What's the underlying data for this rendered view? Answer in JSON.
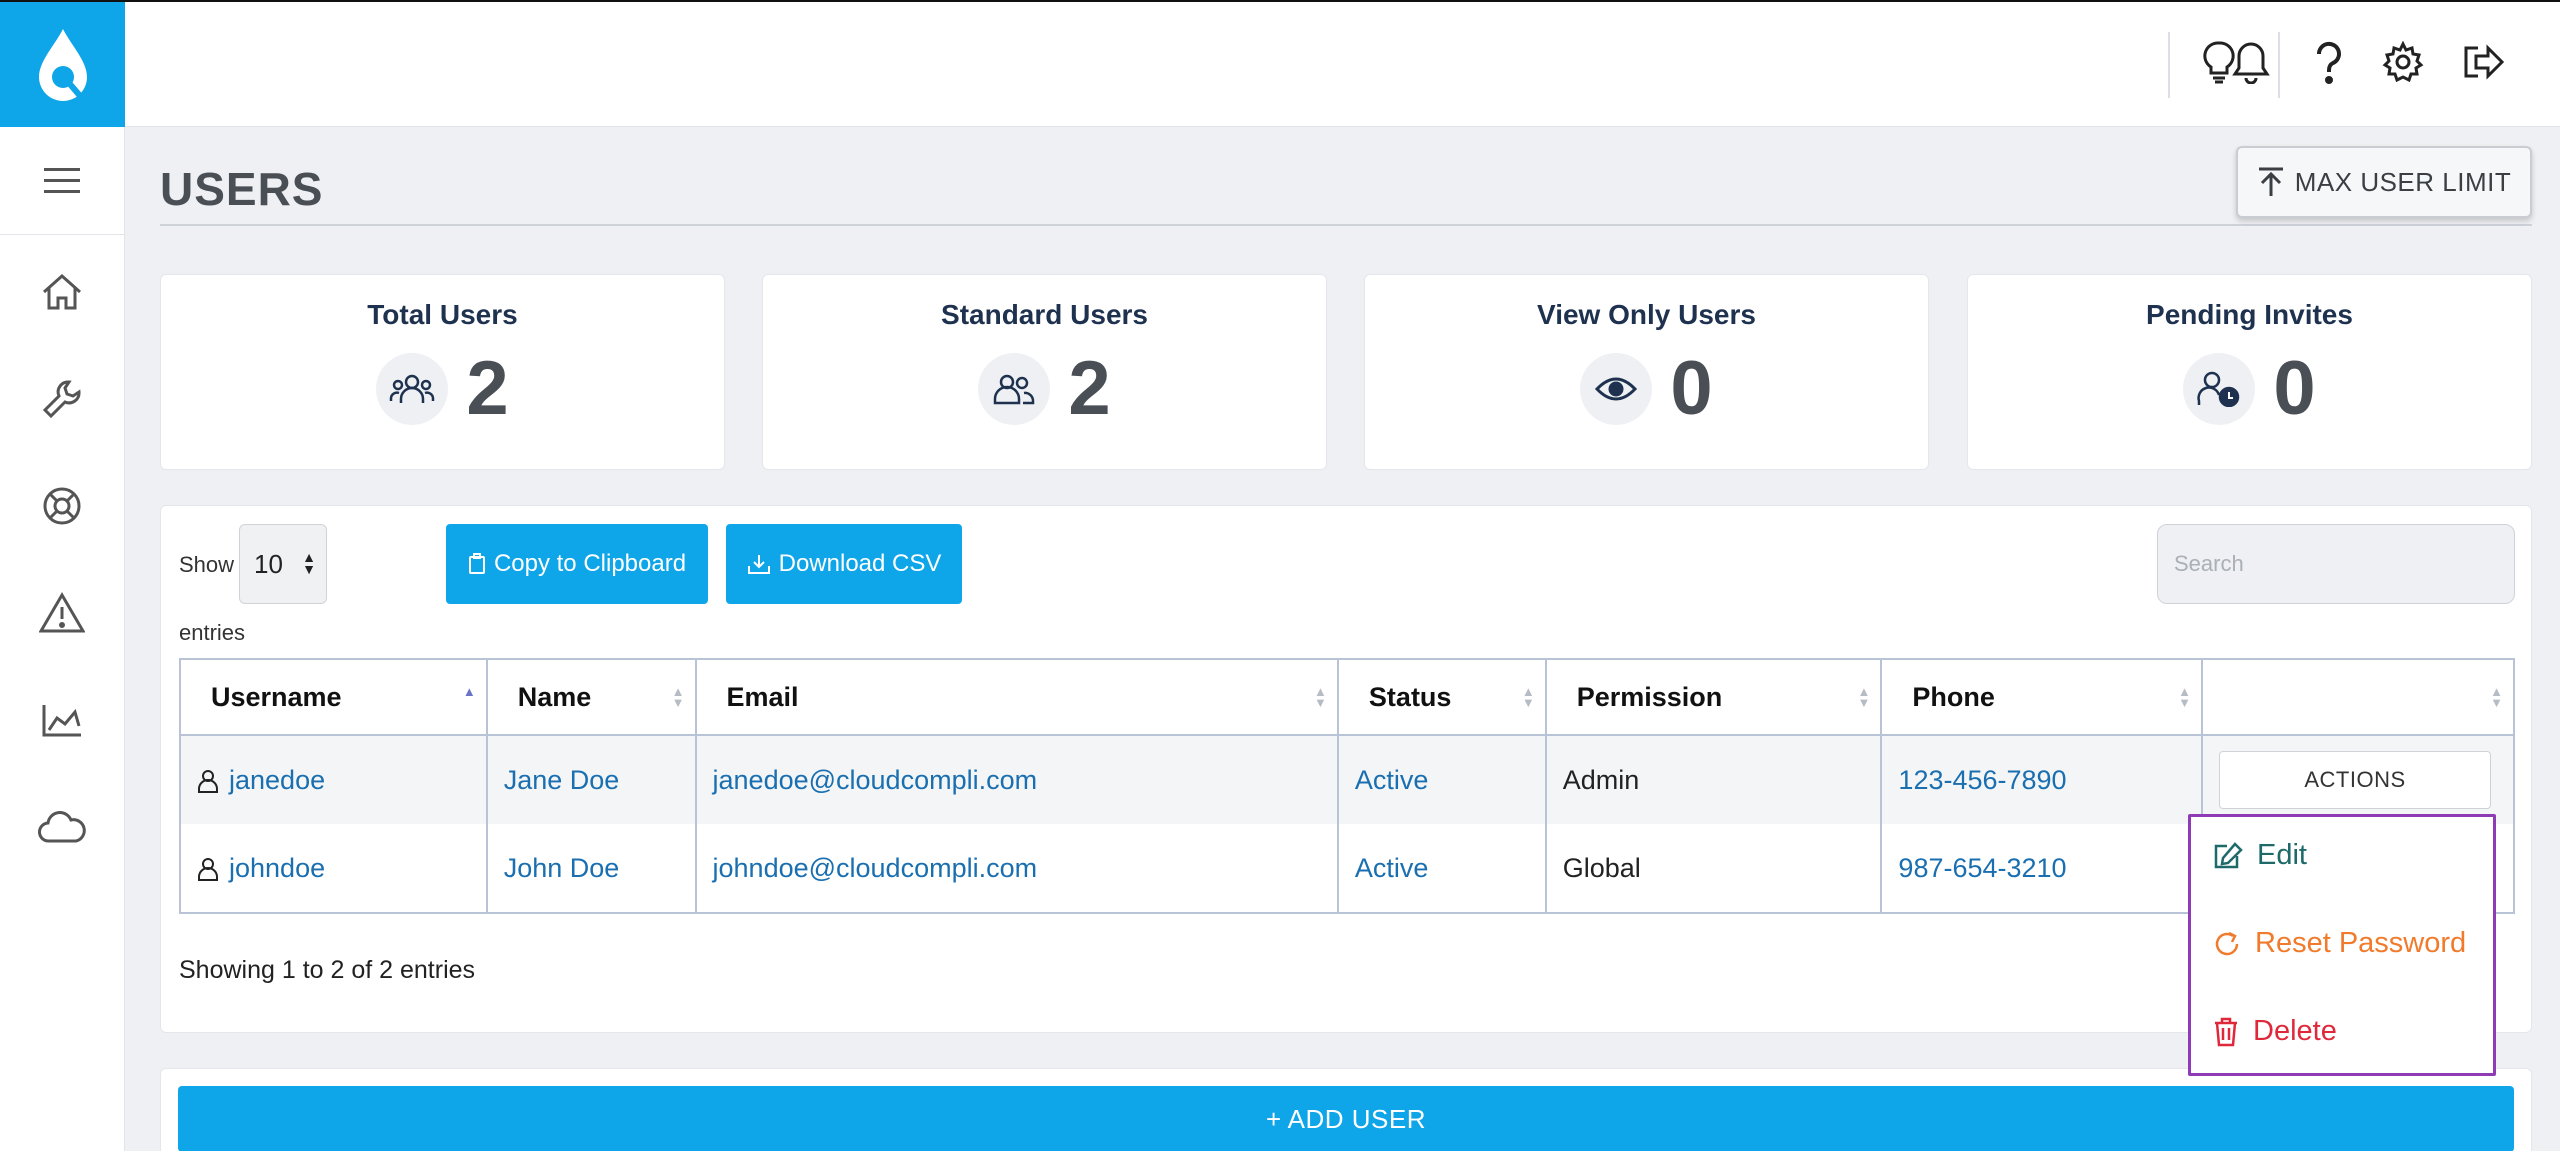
{
  "sidebar": {
    "logo_icon": "water-drop-logo",
    "menu_icon": "hamburger-icon",
    "items": [
      {
        "icon": "home-icon"
      },
      {
        "icon": "wrench-icon"
      },
      {
        "icon": "lifebuoy-icon"
      },
      {
        "icon": "warning-icon"
      },
      {
        "icon": "chart-icon"
      },
      {
        "icon": "cloud-icon"
      }
    ]
  },
  "topbar": {
    "icons": [
      "lightbulb-icon",
      "bell-icon",
      "help-icon",
      "gear-icon",
      "logout-icon"
    ]
  },
  "page": {
    "title": "USERS",
    "max_user_limit_label": "MAX USER LIMIT"
  },
  "stats": [
    {
      "label": "Total Users",
      "value": "2",
      "icon": "users-group-icon"
    },
    {
      "label": "Standard Users",
      "value": "2",
      "icon": "users-icon"
    },
    {
      "label": "View Only Users",
      "value": "0",
      "icon": "eye-icon"
    },
    {
      "label": "Pending Invites",
      "value": "0",
      "icon": "user-clock-icon"
    }
  ],
  "table_controls": {
    "show_label": "Show",
    "page_size": "10",
    "entries_label": "entries",
    "copy_label": "Copy to Clipboard",
    "download_label": "Download CSV",
    "search_placeholder": "Search"
  },
  "table": {
    "columns": [
      "Username",
      "Name",
      "Email",
      "Status",
      "Permission",
      "Phone",
      ""
    ],
    "rows": [
      {
        "username": "janedoe",
        "name": "Jane Doe",
        "email": "janedoe@cloudcompli.com",
        "status": "Active",
        "permission": "Admin",
        "phone": "123-456-7890",
        "actions": "ACTIONS"
      },
      {
        "username": "johndoe",
        "name": "John Doe",
        "email": "johndoe@cloudcompli.com",
        "status": "Active",
        "permission": "Global",
        "phone": "987-654-3210"
      }
    ],
    "footer": "Showing 1 to 2 of 2 entries"
  },
  "actions_menu": {
    "edit": "Edit",
    "reset": "Reset Password",
    "delete": "Delete",
    "colors": {
      "edit": "#1e6a6a",
      "reset": "#f07b2c",
      "delete": "#e0283b",
      "border": "#8e3bb5"
    }
  },
  "add_user_label": "ADD USER",
  "colors": {
    "accent": "#0ea5e9",
    "title": "#4a4f56"
  }
}
